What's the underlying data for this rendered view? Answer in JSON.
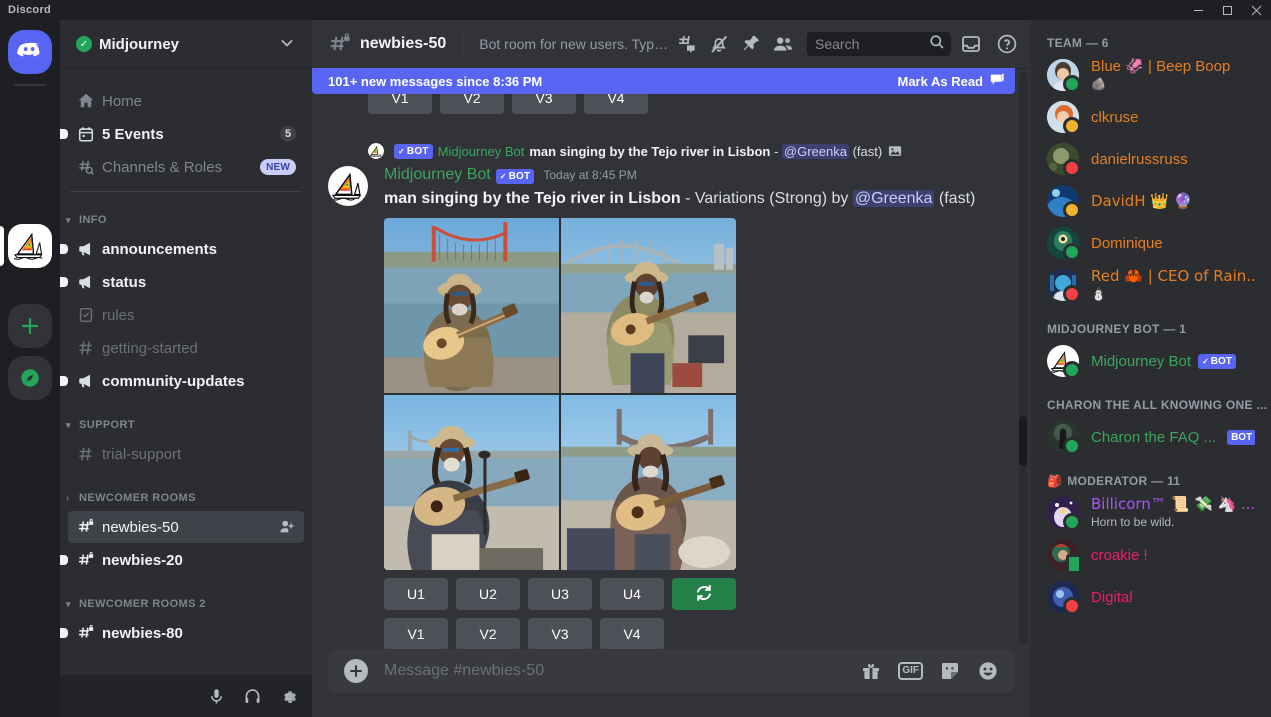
{
  "window": {
    "app_title": "Discord",
    "minimize_label": "—",
    "maximize_label": "□",
    "close_label": "✕"
  },
  "rail": {
    "home_icon": "discord-home-icon",
    "server_name": "Midjourney",
    "add_server_label": "+",
    "explore_label": "compass-icon"
  },
  "guild": {
    "name": "Midjourney",
    "verified_check": "✓",
    "chevron": "▾"
  },
  "sidebar": {
    "nav": [
      {
        "label": "Home",
        "icon": "home-icon",
        "badge": "",
        "state": "normal"
      },
      {
        "label": "5 Events",
        "icon": "calendar-icon",
        "badge": "5",
        "state": "unread"
      },
      {
        "label": "Channels & Roles",
        "icon": "channels-roles-icon",
        "badge": "NEW",
        "state": "normal"
      }
    ],
    "categories": [
      {
        "name": "INFO",
        "collapsed": false,
        "channels": [
          {
            "label": "announcements",
            "icon": "announcement-icon",
            "state": "unread"
          },
          {
            "label": "status",
            "icon": "announcement-icon",
            "state": "unread"
          },
          {
            "label": "rules",
            "icon": "rules-icon",
            "state": "muted"
          },
          {
            "label": "getting-started",
            "icon": "hash-icon",
            "state": "muted"
          },
          {
            "label": "community-updates",
            "icon": "announcement-icon",
            "state": "unread"
          }
        ]
      },
      {
        "name": "SUPPORT",
        "collapsed": false,
        "channels": [
          {
            "label": "trial-support",
            "icon": "hash-icon",
            "state": "muted"
          }
        ]
      },
      {
        "name": "NEWCOMER ROOMS",
        "collapsed": true,
        "channels": [
          {
            "label": "newbies-50",
            "icon": "hash-lock-icon",
            "state": "active",
            "action_icon": "add-member-icon"
          },
          {
            "label": "newbies-20",
            "icon": "hash-lock-icon",
            "state": "unread"
          }
        ]
      },
      {
        "name": "NEWCOMER ROOMS 2",
        "collapsed": false,
        "channels": [
          {
            "label": "newbies-80",
            "icon": "hash-lock-icon",
            "state": "unread"
          }
        ]
      }
    ],
    "user_controls": [
      {
        "name": "mute-microphone-button",
        "icon": "microphone-icon"
      },
      {
        "name": "deafen-button",
        "icon": "headphones-icon"
      },
      {
        "name": "user-settings-button",
        "icon": "gear-icon"
      }
    ]
  },
  "channel_header": {
    "name": "newbies-50",
    "topic": "Bot room for new users. Type /imagine then describe what you ...",
    "buttons": [
      {
        "name": "threads-button",
        "icon": "threads-icon"
      },
      {
        "name": "notification-settings-button",
        "icon": "bell-off-icon"
      },
      {
        "name": "pinned-messages-button",
        "icon": "pin-icon"
      },
      {
        "name": "member-list-button",
        "icon": "members-icon"
      }
    ],
    "search_placeholder": "Search",
    "inbox_icon": "inbox-icon",
    "help_icon": "help-icon"
  },
  "new_messages_banner": {
    "text": "101+ new messages since 8:36 PM",
    "mark_as_read": "Mark As Read"
  },
  "previous_message_buttons": [
    "V1",
    "V2",
    "V3",
    "V4"
  ],
  "message": {
    "reply_context": {
      "author": "Midjourney Bot",
      "bot_tag": "BOT",
      "bot_check": "✓",
      "text_bold": "man singing by the Tejo river in Lisbon",
      "text_dash": " - ",
      "mention": "@Greenka",
      "suffix": " (fast)",
      "attachment_icon": "image-attachment-icon"
    },
    "author": "Midjourney Bot",
    "bot_tag": "BOT",
    "bot_check": "✓",
    "timestamp": "Today at 8:45 PM",
    "content_bold": "man singing by the Tejo river in Lisbon",
    "content_mid": " - Variations (Strong) by ",
    "content_mention": "@Greenka",
    "content_suffix": " (fast)",
    "image_alt": "2x2 grid of generated images of a man with dreadlocks and hat playing acoustic guitar by a river with a suspension bridge",
    "action_buttons_row1": [
      "U1",
      "U2",
      "U3",
      "U4"
    ],
    "refresh_button": "refresh-icon",
    "action_buttons_row2": [
      "V1",
      "V2",
      "V3",
      "V4"
    ]
  },
  "composer": {
    "placeholder": "Message #newbies-50",
    "add_label": "+",
    "buttons": [
      {
        "name": "gift-button",
        "icon": "gift-icon"
      },
      {
        "name": "gif-button",
        "icon": "gif-icon",
        "label": "GIF"
      },
      {
        "name": "sticker-button",
        "icon": "sticker-icon"
      },
      {
        "name": "emoji-button",
        "icon": "emoji-icon"
      }
    ]
  },
  "members": {
    "groups": [
      {
        "title": "TEAM — 6",
        "icon": "",
        "members": [
          {
            "name": "Blue 🦑 | Beep Boop",
            "sub": "🪨",
            "status": "online",
            "color": "#e67e22",
            "avatar": "#c8d8e4"
          },
          {
            "name": "clkruse",
            "sub": "",
            "status": "idle",
            "color": "#e67e22",
            "avatar": "#e8c9a8"
          },
          {
            "name": "danielrussruss",
            "sub": "",
            "status": "dnd",
            "color": "#e67e22",
            "avatar": "#4d5a3a"
          },
          {
            "name": "DavidH 👑 🔮",
            "sub": "",
            "status": "idle",
            "color": "#e67e22",
            "avatar": "#1b4f8c"
          },
          {
            "name": "Dominique",
            "sub": "",
            "status": "online",
            "color": "#e67e22",
            "avatar": "#1d6152"
          },
          {
            "name": "Red 🦀 | CEO of Rain...",
            "sub": "⛄",
            "status": "dnd",
            "color": "#e67e22",
            "avatar": "#2a3f6b"
          }
        ]
      },
      {
        "title": "MIDJOURNEY BOT — 1",
        "icon": "",
        "members": [
          {
            "name": "Midjourney Bot",
            "sub": "",
            "status": "online",
            "color": "#3ba55c",
            "avatar": "#ffffff",
            "bot": "BOT",
            "bot_check": "✓"
          }
        ]
      },
      {
        "title": "CHARON THE ALL KNOWING ONE ...",
        "icon": "",
        "members": [
          {
            "name": "Charon the FAQ ...",
            "sub": "",
            "status": "online",
            "color": "#3ba55c",
            "avatar": "#2f3b38",
            "bot": "BOT"
          }
        ]
      },
      {
        "title": "MODERATOR — 11",
        "icon": "🎒",
        "members": [
          {
            "name": "Billicorn™ 📜 💸 🦄 ...",
            "sub": "Horn to be wild.",
            "status": "online",
            "color": "#a855f7",
            "avatar": "#3d2a5c"
          },
          {
            "name": "croakie !",
            "sub": "",
            "status": "mobile",
            "color": "#e91e63",
            "avatar": "#4a2a33"
          },
          {
            "name": "Digital",
            "sub": "",
            "status": "dnd",
            "color": "#e91e63",
            "avatar": "#26386b"
          }
        ]
      }
    ]
  },
  "colors": {
    "brand": "#5865f2",
    "online": "#23a55a",
    "idle": "#f0b232",
    "dnd": "#f23f43",
    "bot_green": "#3ba55c"
  }
}
